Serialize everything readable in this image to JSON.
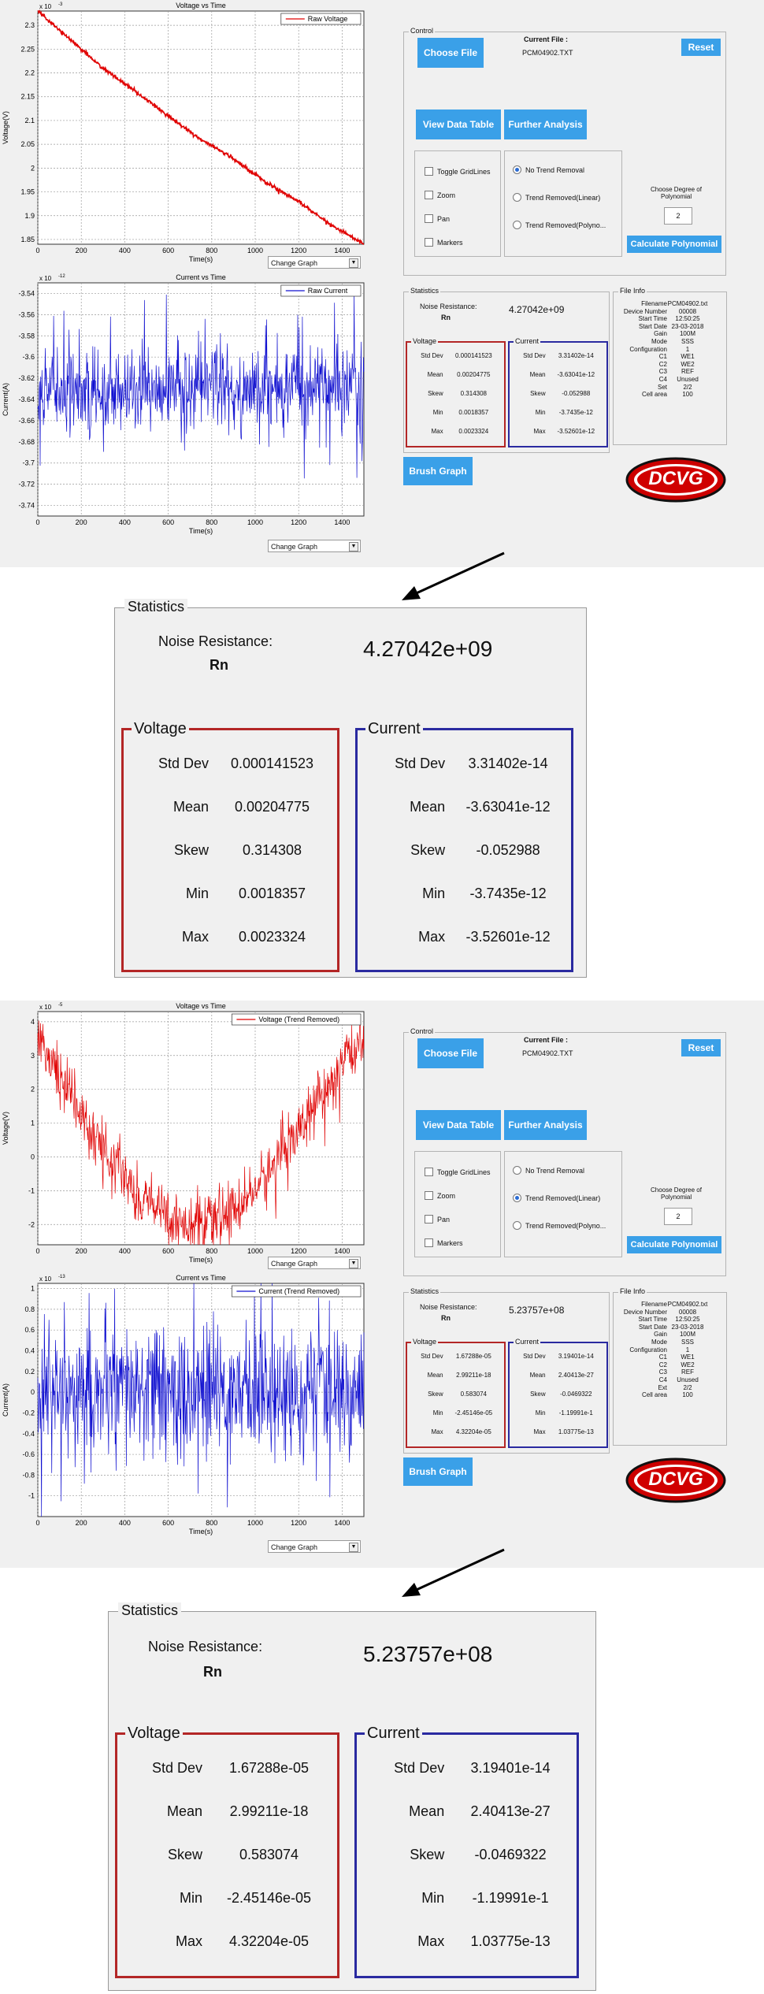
{
  "screens": [
    {
      "charts": [
        {
          "title": "Voltage vs Time",
          "xlabel": "Time(s)",
          "ylabel": "Voltage(V)",
          "exponent": "x 10",
          "exp_power": "-3",
          "legend": "Raw Voltage",
          "line_color": "#e00000",
          "yticks": [
            "2.3",
            "2.25",
            "2.2",
            "2.15",
            "2.1",
            "2.05",
            "2",
            "1.95",
            "1.9",
            "1.85"
          ],
          "xticks": [
            "0",
            "200",
            "400",
            "600",
            "800",
            "1000",
            "1200",
            "1400"
          ],
          "change_graph": "Change Graph"
        },
        {
          "title": "Current vs Time",
          "xlabel": "Time(s)",
          "ylabel": "Current(A)",
          "exponent": "x 10",
          "exp_power": "-12",
          "legend": "Raw Current",
          "line_color": "#1010d0",
          "yticks": [
            "-3.54",
            "-3.56",
            "-3.58",
            "-3.6",
            "-3.62",
            "-3.64",
            "-3.66",
            "-3.68",
            "-3.7",
            "-3.72",
            "-3.74"
          ],
          "xticks": [
            "0",
            "200",
            "400",
            "600",
            "800",
            "1000",
            "1200",
            "1400"
          ],
          "change_graph": "Change Graph"
        }
      ],
      "control": {
        "caption": "Control",
        "current_file_label": "Current File :",
        "current_file": "PCM04902.TXT",
        "choose_file": "Choose File",
        "reset": "Reset",
        "view_data_table": "View Data Table",
        "further_analysis": "Further Analysis",
        "checks": [
          "Toggle GridLines",
          "Zoom",
          "Pan",
          "Markers"
        ],
        "radios": [
          "No Trend Removal",
          "Trend Removed(Linear)",
          "Trend Removed(Polyno..."
        ],
        "selected_radio": 0,
        "degree_label_1": "Choose Degree of",
        "degree_label_2": "Polynomial",
        "degree_value": "2",
        "calc_poly": "Calculate Polynomial"
      },
      "stats": {
        "caption": "Statistics",
        "noise_label": "Noise Resistance:",
        "rn": "Rn",
        "noise_value": "4.27042e+09",
        "voltage_caption": "Voltage",
        "current_caption": "Current",
        "keys": [
          "Std Dev",
          "Mean",
          "Skew",
          "Min",
          "Max"
        ],
        "voltage": [
          "0.000141523",
          "0.00204775",
          "0.314308",
          "0.0018357",
          "0.0023324"
        ],
        "current": [
          "3.31402e-14",
          "-3.63041e-12",
          "-0.052988",
          "-3.7435e-12",
          "-3.52601e-12"
        ]
      },
      "file_info": {
        "caption": "File Info",
        "keys": [
          "Filename",
          "Device Number",
          "Start Time",
          "Start Date",
          "Gain",
          "Mode",
          "Configuration",
          "C1",
          "C2",
          "C3",
          "C4",
          "Set",
          "Cell area"
        ],
        "values": [
          "PCM04902.txt",
          "00008",
          "12:50:25",
          "23-03-2018",
          "100M",
          "SSS",
          "1",
          "WE1",
          "WE2",
          "REF",
          "Unused",
          "2/2",
          "100"
        ]
      },
      "brush_graph": "Brush Graph",
      "logo": "DCVG"
    },
    {
      "charts": [
        {
          "title": "Voltage vs Time",
          "xlabel": "Time(s)",
          "ylabel": "Voltage(V)",
          "exponent": "x 10",
          "exp_power": "-5",
          "legend": "Voltage (Trend Removed)",
          "line_color": "#e00000",
          "yticks": [
            "4",
            "3",
            "2",
            "1",
            "0",
            "-1",
            "-2"
          ],
          "xticks": [
            "0",
            "200",
            "400",
            "600",
            "800",
            "1000",
            "1200",
            "1400"
          ],
          "change_graph": "Change Graph"
        },
        {
          "title": "Current vs Time",
          "xlabel": "Time(s)",
          "ylabel": "Current(A)",
          "exponent": "x 10",
          "exp_power": "-13",
          "legend": "Current (Trend Removed)",
          "line_color": "#1010d0",
          "yticks": [
            "1",
            "0.8",
            "0.6",
            "0.4",
            "0.2",
            "0",
            "-0.2",
            "-0.4",
            "-0.6",
            "-0.8",
            "-1"
          ],
          "xticks": [
            "0",
            "200",
            "400",
            "600",
            "800",
            "1000",
            "1200",
            "1400"
          ],
          "change_graph": "Change Graph"
        }
      ],
      "control": {
        "caption": "Control",
        "current_file_label": "Current File :",
        "current_file": "PCM04902.TXT",
        "choose_file": "Choose File",
        "reset": "Reset",
        "view_data_table": "View Data Table",
        "further_analysis": "Further Analysis",
        "checks": [
          "Toggle GridLines",
          "Zoom",
          "Pan",
          "Markers"
        ],
        "radios": [
          "No Trend Removal",
          "Trend Removed(Linear)",
          "Trend Removed(Polyno..."
        ],
        "selected_radio": 1,
        "degree_label_1": "Choose Degree of",
        "degree_label_2": "Polynomial",
        "degree_value": "2",
        "calc_poly": "Calculate Polynomial"
      },
      "stats": {
        "caption": "Statistics",
        "noise_label": "Noise Resistance:",
        "rn": "Rn",
        "noise_value": "5.23757e+08",
        "voltage_caption": "Voltage",
        "current_caption": "Current",
        "keys": [
          "Std Dev",
          "Mean",
          "Skew",
          "Min",
          "Max"
        ],
        "voltage": [
          "1.67288e-05",
          "2.99211e-18",
          "0.583074",
          "-2.45146e-05",
          "4.32204e-05"
        ],
        "current": [
          "3.19401e-14",
          "2.40413e-27",
          "-0.0469322",
          "-1.19991e-1",
          "1.03775e-13"
        ]
      },
      "file_info": {
        "caption": "File Info",
        "keys": [
          "Filename",
          "Device Number",
          "Start Time",
          "Start Date",
          "Gain",
          "Mode",
          "Configuration",
          "C1",
          "C2",
          "C3",
          "C4",
          "Ext",
          "Cell area"
        ],
        "values": [
          "PCM04902.txt",
          "00008",
          "12:50:25",
          "23-03-2018",
          "100M",
          "SSS",
          "1",
          "WE1",
          "WE2",
          "REF",
          "Unused",
          "2/2",
          "100"
        ]
      },
      "brush_graph": "Brush Graph",
      "logo": "DCVG"
    }
  ],
  "zooms": [
    {
      "caption": "Statistics",
      "noise_label": "Noise Resistance:",
      "rn": "Rn",
      "noise_value": "4.27042e+09",
      "voltage_caption": "Voltage",
      "current_caption": "Current",
      "keys": [
        "Std Dev",
        "Mean",
        "Skew",
        "Min",
        "Max"
      ],
      "voltage": [
        "0.000141523",
        "0.00204775",
        "0.314308",
        "0.0018357",
        "0.0023324"
      ],
      "current": [
        "3.31402e-14",
        "-3.63041e-12",
        "-0.052988",
        "-3.7435e-12",
        "-3.52601e-12"
      ]
    },
    {
      "caption": "Statistics",
      "noise_label": "Noise Resistance:",
      "rn": "Rn",
      "noise_value": "5.23757e+08",
      "voltage_caption": "Voltage",
      "current_caption": "Current",
      "keys": [
        "Std Dev",
        "Mean",
        "Skew",
        "Min",
        "Max"
      ],
      "voltage": [
        "1.67288e-05",
        "2.99211e-18",
        "0.583074",
        "-2.45146e-05",
        "4.32204e-05"
      ],
      "current": [
        "3.19401e-14",
        "2.40413e-27",
        "-0.0469322",
        "-1.19991e-1",
        "1.03775e-13"
      ]
    }
  ],
  "chart_data": [
    {
      "type": "line",
      "title": "Voltage vs Time",
      "xlabel": "Time(s)",
      "ylabel": "Voltage(V)",
      "xlim": [
        0,
        1500
      ],
      "ylim": [
        1.84,
        2.33
      ],
      "y_scale": "x 10^-3",
      "grid": true,
      "legend": "top-right",
      "series": [
        {
          "name": "Raw Voltage",
          "x": [
            0,
            150,
            300,
            450,
            600,
            750,
            900,
            1050,
            1200,
            1350,
            1500
          ],
          "y": [
            2.33,
            2.27,
            2.21,
            2.16,
            2.11,
            2.06,
            2.02,
            1.97,
            1.93,
            1.88,
            1.84
          ]
        }
      ]
    },
    {
      "type": "line",
      "title": "Current vs Time",
      "xlabel": "Time(s)",
      "ylabel": "Current(A)",
      "xlim": [
        0,
        1500
      ],
      "ylim": [
        -3.75,
        -3.53
      ],
      "y_scale": "x 10^-12",
      "grid": true,
      "legend": "top-right",
      "series": [
        {
          "name": "Raw Current",
          "x": [
            0,
            1500
          ],
          "y": [
            -3.63,
            -3.63
          ]
        }
      ]
    },
    {
      "type": "line",
      "title": "Voltage vs Time",
      "xlabel": "Time(s)",
      "ylabel": "Voltage(V)",
      "xlim": [
        0,
        1500
      ],
      "ylim": [
        -2.6,
        4.3
      ],
      "y_scale": "x 10^-5",
      "grid": true,
      "legend": "top-right",
      "series": [
        {
          "name": "Voltage (Trend Removed)",
          "x": [
            0,
            150,
            300,
            450,
            600,
            750,
            900,
            1050,
            1200,
            1350,
            1500
          ],
          "y": [
            3.6,
            1.8,
            0.2,
            -1.0,
            -1.8,
            -2.1,
            -1.6,
            -0.6,
            0.8,
            2.2,
            3.6
          ]
        }
      ]
    },
    {
      "type": "line",
      "title": "Current vs Time",
      "xlabel": "Time(s)",
      "ylabel": "Current(A)",
      "xlim": [
        0,
        1500
      ],
      "ylim": [
        -1.2,
        1.05
      ],
      "y_scale": "x 10^-13",
      "grid": true,
      "legend": "top-right",
      "series": [
        {
          "name": "Current (Trend Removed)",
          "x": [
            0,
            1500
          ],
          "y": [
            0,
            0
          ]
        }
      ]
    }
  ]
}
